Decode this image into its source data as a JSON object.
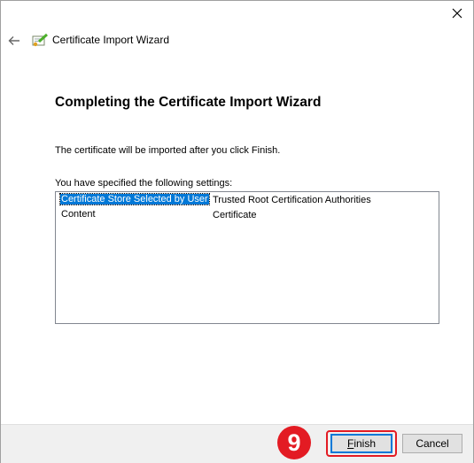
{
  "window": {
    "title": "Certificate Import Wizard",
    "close_icon": "close-icon",
    "back_icon": "back-arrow-icon",
    "wizard_icon": "certificate-icon"
  },
  "main": {
    "heading": "Completing the Certificate Import Wizard",
    "description": "The certificate will be imported after you click Finish.",
    "settings_label": "You have specified the following settings:",
    "settings": [
      {
        "key": "Certificate Store Selected by User",
        "value": "Trusted Root Certification Authorities"
      },
      {
        "key": "Content",
        "value": "Certificate"
      }
    ]
  },
  "annotation": {
    "step": "9",
    "color": "#e31b23"
  },
  "footer": {
    "finish_label": "Finish",
    "cancel_label": "Cancel"
  },
  "colors": {
    "selection": "#0078d7",
    "accent": "#e31b23"
  }
}
